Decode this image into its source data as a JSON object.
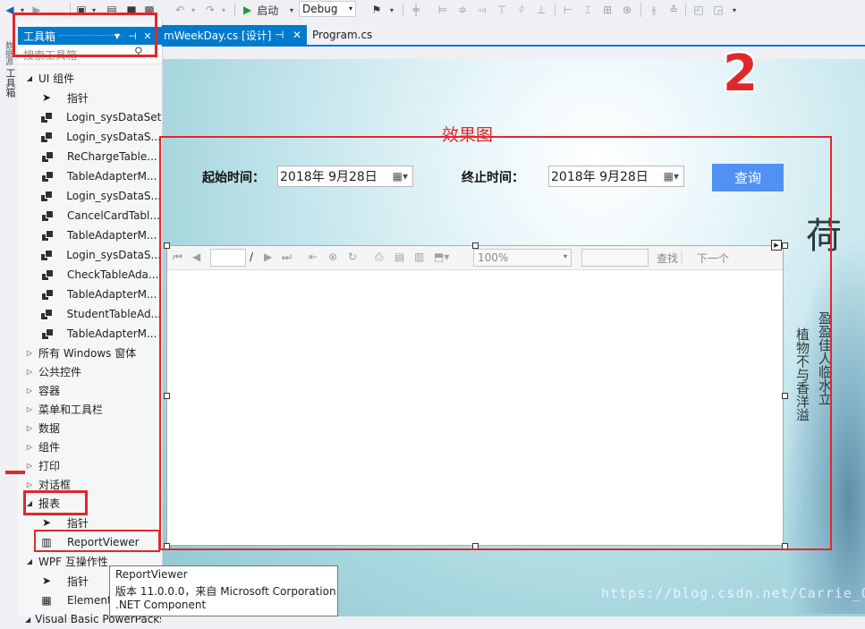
{
  "toolbar": {
    "start_label": "启动",
    "config_value": "Debug"
  },
  "side_tab": {
    "label_1": "数据源",
    "label_2": "工具箱"
  },
  "toolbox": {
    "title": "工具箱",
    "search_placeholder": "搜索工具箱",
    "ui_group_label": "UI 组件",
    "ui_items": [
      "指针",
      "Login_sysDataSet",
      "Login_sysDataS...",
      "ReChargeTable...",
      "TableAdapterM...",
      "Login_sysDataS...",
      "CancelCardTabl...",
      "TableAdapterM...",
      "Login_sysDataS...",
      "CheckTableAda...",
      "TableAdapterM...",
      "StudentTableAd...",
      "TableAdapterM..."
    ],
    "categories": [
      "所有 Windows 窗体",
      "公共控件",
      "容器",
      "菜单和工具栏",
      "数据",
      "组件",
      "打印",
      "对话框"
    ],
    "report_group_label": "报表",
    "report_items": [
      "指针",
      "ReportViewer"
    ],
    "wpf_group_label": "WPF 互操作性",
    "wpf_items": [
      "指针",
      "ElementHost"
    ],
    "last_group_label": "Visual Basic PowerPacks"
  },
  "tabs": [
    {
      "label": "mWeekDay.cs [设计]"
    },
    {
      "label": "Program.cs"
    }
  ],
  "form": {
    "start_label": "起始时间：",
    "start_value": "2018年  9月28日",
    "end_label": "终止时间：",
    "end_value": "2018年  9月28日",
    "query_button": "查询"
  },
  "report_viewer": {
    "zoom": "100%",
    "find_label": "查找",
    "next_label": "下一个",
    "page_separator": "/"
  },
  "annotations": {
    "big_number": "2",
    "effect_label": "效果图",
    "red_color": "#e0282b"
  },
  "decor": {
    "calligraphy_main": "荷",
    "calligraphy_col1": "盈盈佳人临水立",
    "calligraphy_col2": "植物不与香洋溢",
    "watermark": "https://blog.csdn.net/Carrie_Q"
  },
  "tooltip": {
    "title": "ReportViewer",
    "version": "版本 11.0.0.0，来自 Microsoft Corporation",
    "kind": ".NET Component"
  },
  "colors": {
    "accent": "#007acc",
    "button_blue": "#5291f2"
  }
}
